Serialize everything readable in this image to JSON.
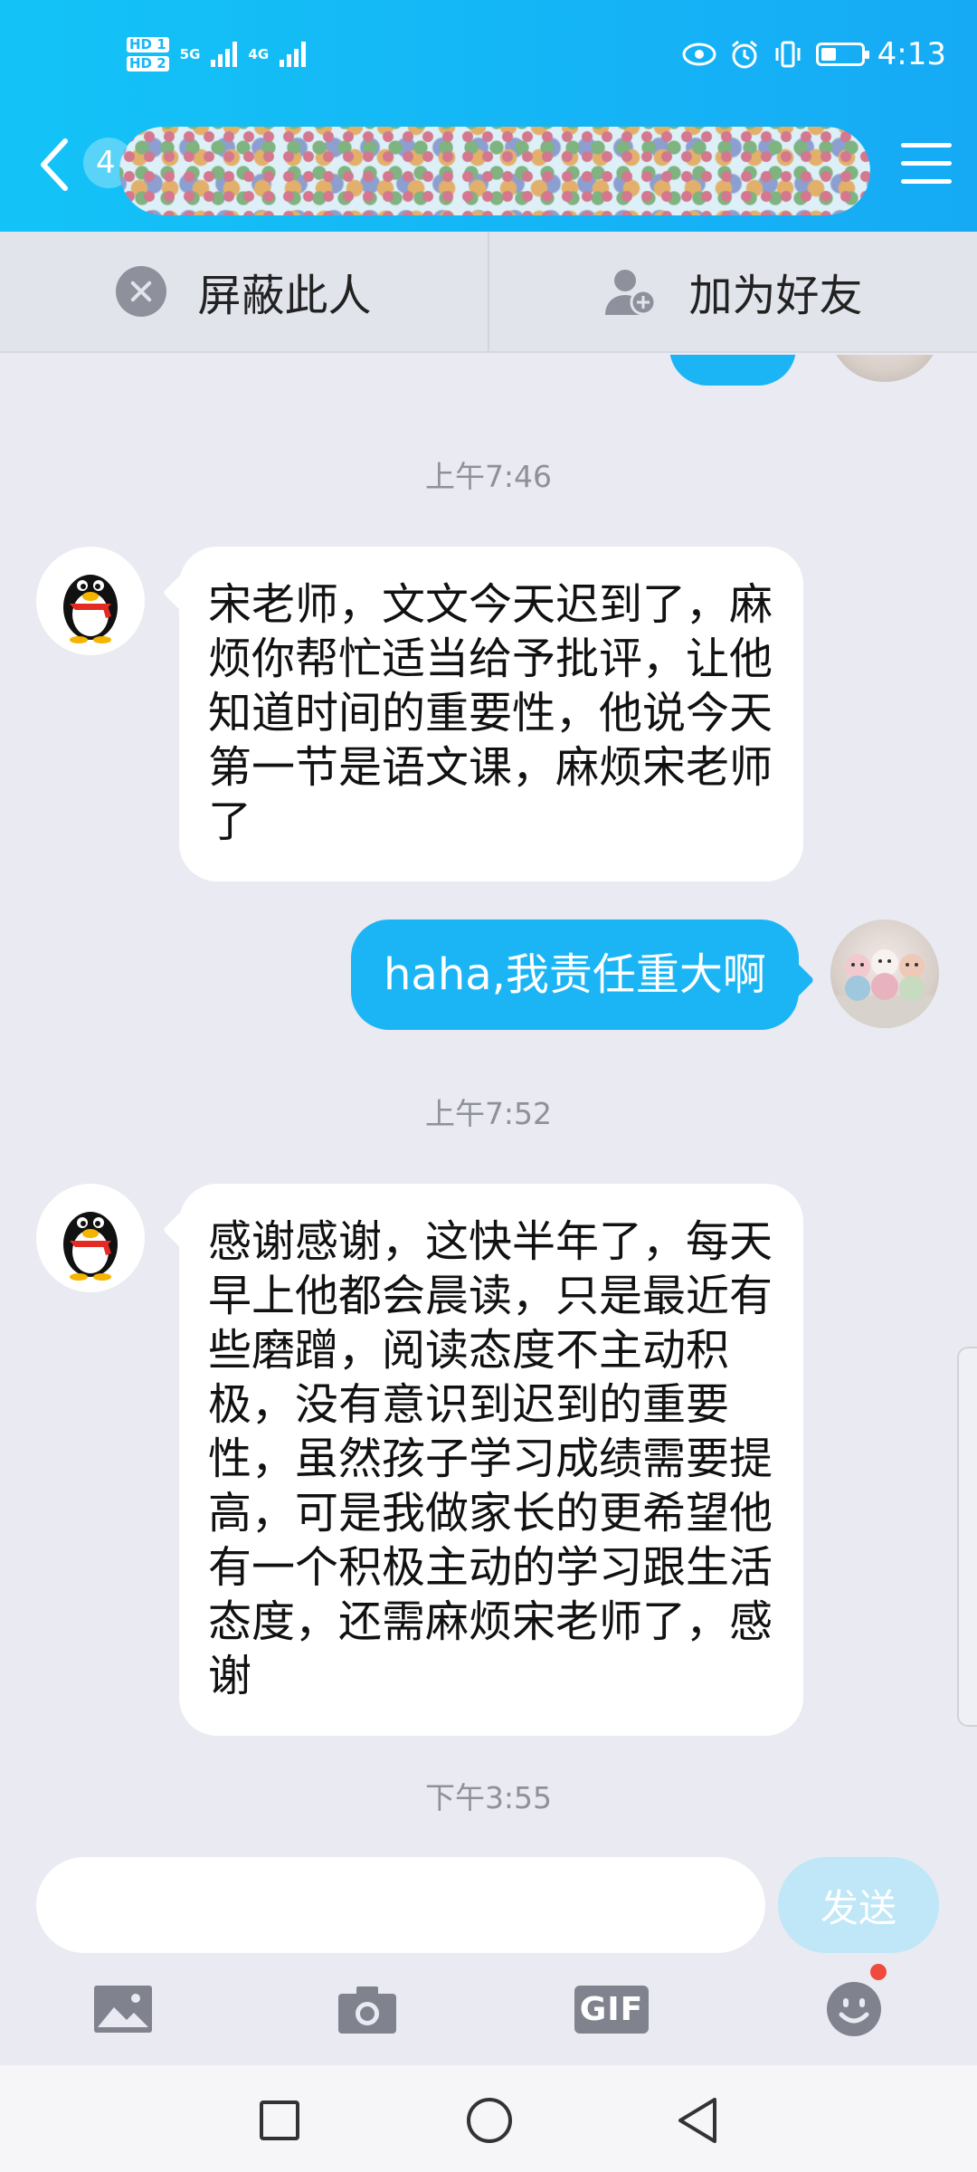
{
  "status_bar": {
    "sim1": "HD 1",
    "sim2": "HD 2",
    "net1": "5G",
    "net2": "4G",
    "time": "4:13",
    "battery_level": 0.35
  },
  "header": {
    "unread_count": "4",
    "contact_name_redacted": true
  },
  "actions": {
    "block": "屏蔽此人",
    "add_friend": "加为好友"
  },
  "messages": [
    {
      "type": "time",
      "text": "上午7:46"
    },
    {
      "type": "incoming",
      "text": "宋老师，文文今天迟到了，麻烦你帮忙适当给予批评，让他知道时间的重要性，他说今天第一节是语文课，麻烦宋老师了"
    },
    {
      "type": "outgoing",
      "text": "haha,我责任重大啊"
    },
    {
      "type": "time",
      "text": "上午7:52"
    },
    {
      "type": "incoming",
      "text": "感谢感谢，这快半年了，每天早上他都会晨读，只是最近有些磨蹭，阅读态度不主动积极，没有意识到迟到的重要性，虽然孩子学习成绩需要提高，可是我做家长的更希望他有一个积极主动的学习跟生活态度，还需麻烦宋老师了，感谢"
    },
    {
      "type": "time",
      "text": "下午3:55"
    }
  ],
  "input": {
    "value": "",
    "send_label": "发送"
  },
  "toolbar": {
    "image_icon": "image-icon",
    "camera_icon": "camera-icon",
    "gif_label": "GIF",
    "emoji_icon": "emoji-icon"
  },
  "colors": {
    "header": "#14b8f6",
    "outgoing_bubble": "#1bb5f5",
    "incoming_bubble": "#ffffff",
    "chat_background": "#e9eaf2"
  }
}
